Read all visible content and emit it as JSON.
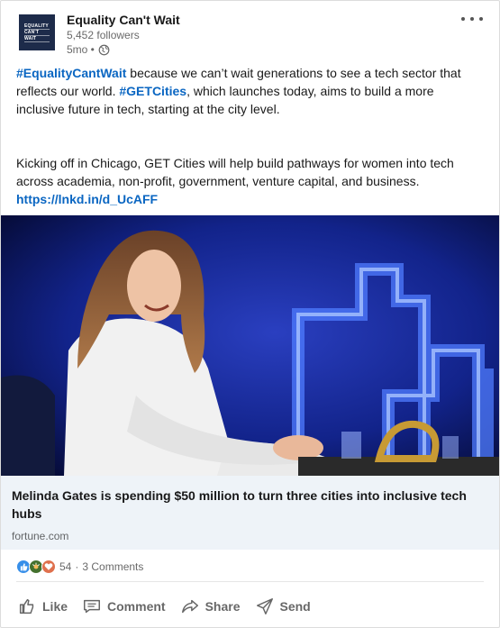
{
  "post": {
    "company_name": "Equality Can't Wait",
    "logo_lines": [
      "EQUALITY",
      "CAN'T",
      "WAIT"
    ],
    "followers": "5,452 followers",
    "time": "5mo •",
    "text_line1_hashtag": "#EqualityCantWait",
    "text_line1_rest": " because we can’t wait generations to see a tech sector that reflects our world. ",
    "text_line1_hashtag2": "#GETCities",
    "text_line1_rest2": ", which launches today, aims to build a more inclusive future in tech, starting at the city level.",
    "text_para2": "Kicking off in Chicago, GET Cities will help build pathways for women into tech across academia, non-profit, government, venture capital, and business.",
    "text_link": "https://lnkd.in/d_UcAFF"
  },
  "article": {
    "title": "Melinda Gates is spending $50 million to turn three cities into inclusive tech hubs",
    "source": "fortune.com"
  },
  "social": {
    "reaction_count": "54",
    "comments": "3 Comments"
  },
  "actions": {
    "like": "Like",
    "comment": "Comment",
    "share": "Share",
    "send": "Send"
  },
  "icons": [
    "globe-icon",
    "more-icon",
    "like-icon",
    "comment-icon",
    "share-icon",
    "send-icon"
  ],
  "colors": {
    "link": "#0a66c2",
    "article_bg": "#eef3f8",
    "reaction_like": "#378fe9",
    "reaction_celebrate": "#44712e",
    "reaction_love": "#df704d"
  }
}
